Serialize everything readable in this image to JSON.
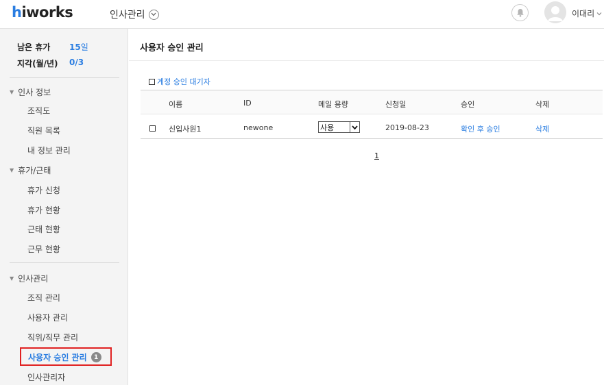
{
  "header": {
    "logo_h": "h",
    "logo_rest": "iworks",
    "app_menu": "인사관리",
    "user_name": "이대리"
  },
  "sidebar": {
    "stats": [
      {
        "label": "남은 휴가",
        "value": "15",
        "unit": "일"
      },
      {
        "label": "지각(월/년)",
        "value": "0/3",
        "unit": ""
      }
    ],
    "sections": [
      {
        "label": "인사 정보",
        "items": [
          "조직도",
          "직원 목록",
          "내 정보 관리"
        ]
      },
      {
        "label": "휴가/근태",
        "items": [
          "휴가 신청",
          "휴가 현황",
          "근태 현황",
          "근무 현황"
        ]
      },
      {
        "label": "인사관리",
        "items": [
          "조직 관리",
          "사용자 관리",
          "직위/직무 관리",
          "사용자 승인 관리",
          "인사관리자"
        ]
      }
    ],
    "active_badge": "1"
  },
  "main": {
    "title": "사용자 승인 관리",
    "filter_label": "계정 승인 대기자",
    "columns": [
      "이름",
      "ID",
      "메일 용량",
      "신청일",
      "승인",
      "삭제"
    ],
    "rows": [
      {
        "name": "신입사원1",
        "id": "newone",
        "mail": "사용",
        "date": "2019-08-23",
        "approve": "확인 후 승인",
        "delete": "삭제"
      }
    ],
    "page": "1"
  },
  "colors": {
    "accent": "#2a7de1",
    "highlight": "#e02020"
  }
}
